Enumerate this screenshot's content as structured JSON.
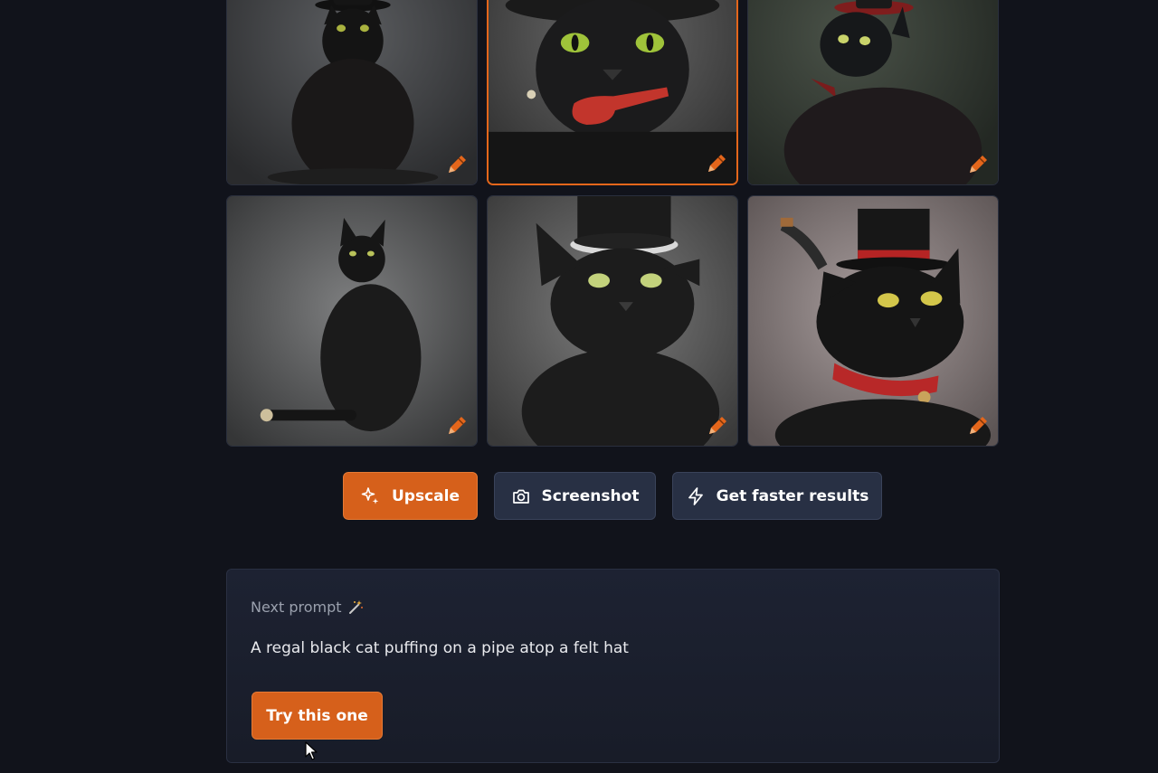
{
  "gallery": {
    "images": [
      {
        "name": "cat-small-bowler-hat",
        "selected": false
      },
      {
        "name": "cat-pipe-hat",
        "selected": true
      },
      {
        "name": "cat-red-top-hat-profile",
        "selected": false
      },
      {
        "name": "cat-sitting-grey-background",
        "selected": false
      },
      {
        "name": "cat-silver-band-top-hat",
        "selected": false
      },
      {
        "name": "cat-top-hat-red-collar-pipe",
        "selected": false
      }
    ],
    "edit_icon": "pencil-icon"
  },
  "actions": {
    "upscale_label": "Upscale",
    "upscale_icon": "sparkle-icon",
    "screenshot_label": "Screenshot",
    "screenshot_icon": "camera-icon",
    "faster_label": "Get faster results",
    "faster_icon": "lightning-icon"
  },
  "next_prompt": {
    "title": "Next prompt",
    "title_icon": "magic-wand-icon",
    "text": "A regal black cat puffing on a pipe atop a felt hat",
    "button_label": "Try this one"
  },
  "colors": {
    "background": "#11131b",
    "accent": "#d6601b",
    "secondary_button": "#283044",
    "card": "#1d2232"
  }
}
